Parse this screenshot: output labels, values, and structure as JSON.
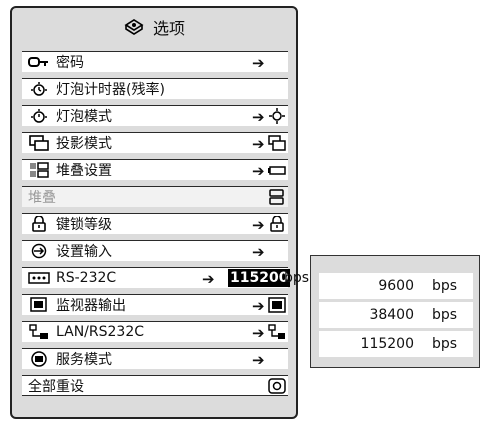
{
  "menu": {
    "title": "选项",
    "items": [
      {
        "label": "密码",
        "arrow": "➔"
      },
      {
        "label": "灯泡计时器(残率)"
      },
      {
        "label": "灯泡模式",
        "arrow": "➔"
      },
      {
        "label": "投影模式",
        "arrow": "➔"
      },
      {
        "label": "堆叠设置",
        "arrow": "➔"
      },
      {
        "label": "堆叠"
      },
      {
        "label": "键锁等级",
        "arrow": "➔"
      },
      {
        "label": "设置输入",
        "arrow": "➔"
      },
      {
        "label": "RS-232C",
        "arrow": "➔",
        "value": "115200",
        "unit": "bps"
      },
      {
        "label": "监视器输出",
        "arrow": "➔"
      },
      {
        "label": "LAN/RS232C",
        "arrow": "➔"
      },
      {
        "label": "服务模式",
        "arrow": "➔"
      },
      {
        "label": "全部重设"
      }
    ]
  },
  "submenu": {
    "options": [
      {
        "value": "9600",
        "unit": "bps"
      },
      {
        "value": "38400",
        "unit": "bps"
      },
      {
        "value": "115200",
        "unit": "bps"
      }
    ]
  }
}
